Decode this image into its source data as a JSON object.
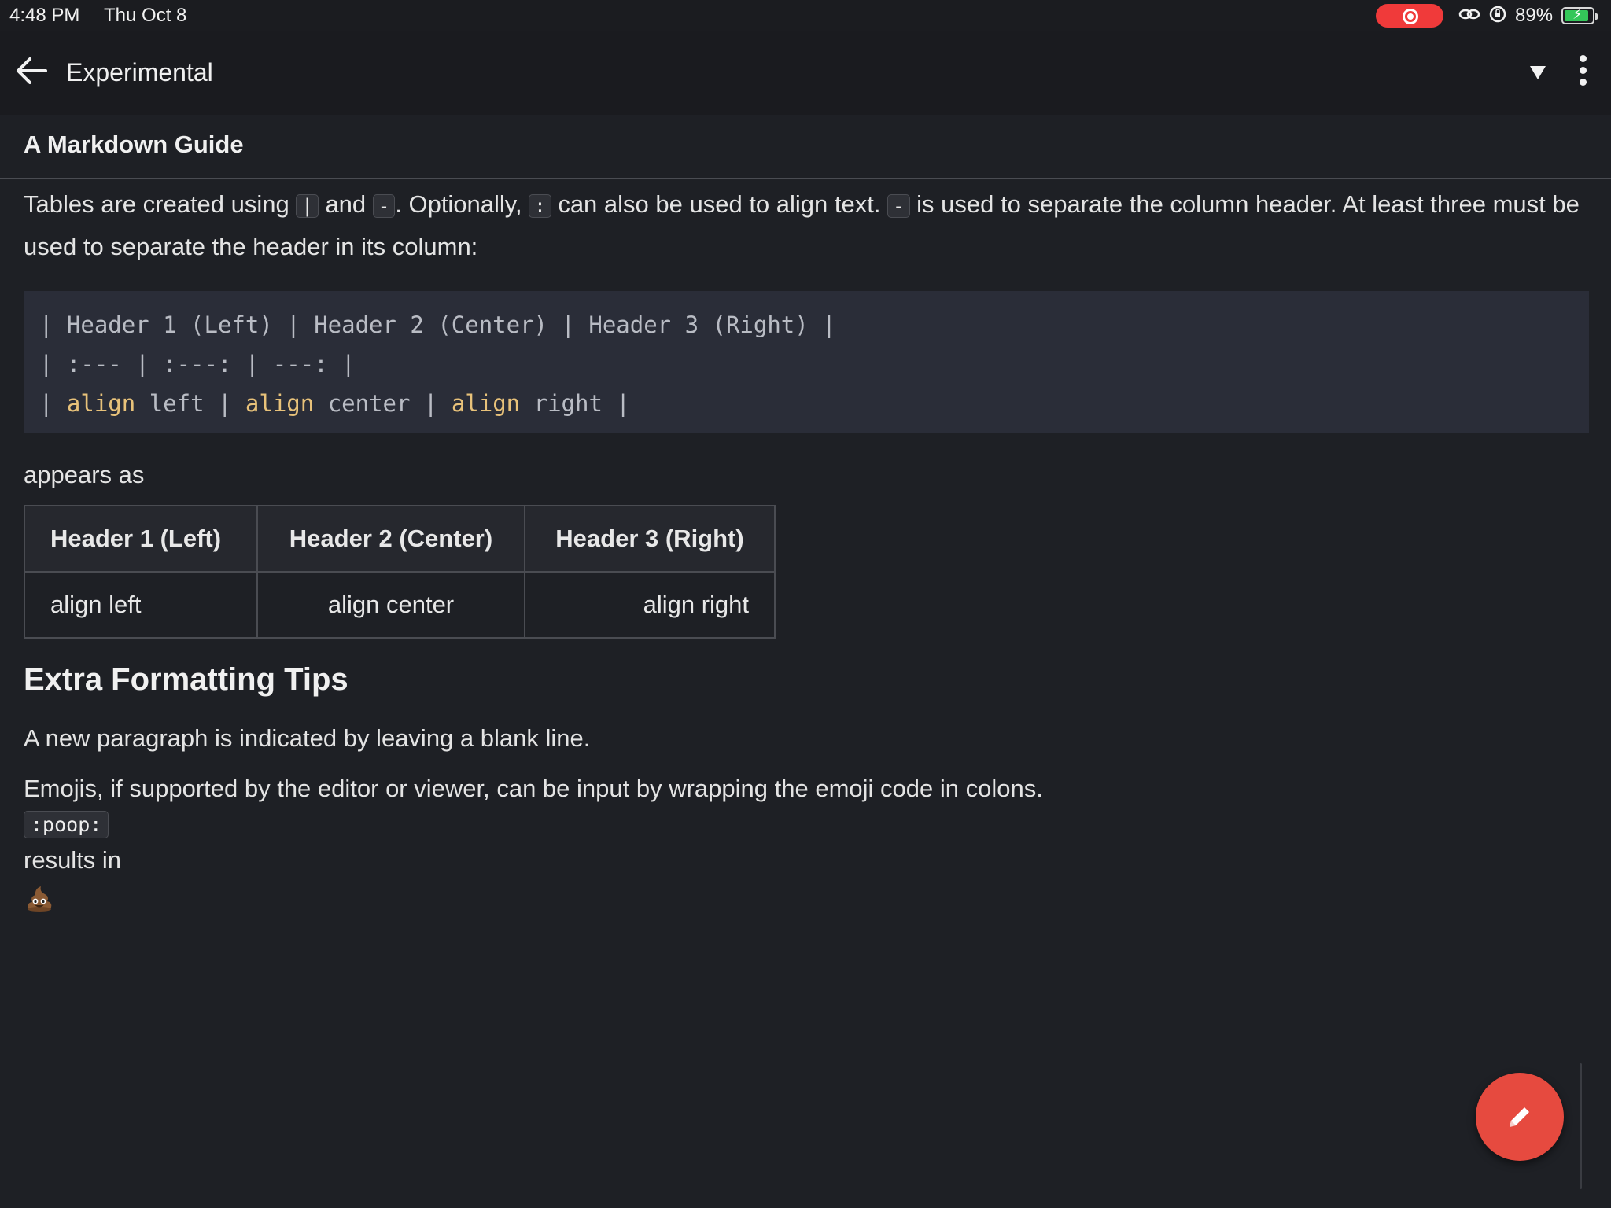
{
  "status_bar": {
    "time": "4:48 PM",
    "date": "Thu Oct 8",
    "battery": "89%",
    "battery_level": 0.89,
    "icons": [
      "screen-record-icon",
      "link-icon",
      "orientation-lock-icon",
      "battery-charging-icon"
    ]
  },
  "app_bar": {
    "title": "Experimental",
    "icons": [
      "back-arrow-icon",
      "dropdown-triangle-icon",
      "more-vertical-icon"
    ]
  },
  "doc": {
    "title": "A Markdown Guide",
    "intro": {
      "t1": "Tables are created using ",
      "c1": "|",
      "t2": " and ",
      "c2": "-",
      "t3": ". Optionally, ",
      "c3": ":",
      "t4": " can also be used to align text. ",
      "c4": "-",
      "t5": " is used to separate the column header. At least three must be used to separate the header in its column:"
    },
    "code_lines": {
      "line1": "| Header 1 (Left) | Header 2 (Center) | Header 3 (Right) |",
      "line2": "| :--- | :---: | ---: |",
      "l3_pipe1": "| ",
      "l3_kw1": "align",
      "l3_t1": " left | ",
      "l3_kw2": "align",
      "l3_t2": " center | ",
      "l3_kw3": "align",
      "l3_t3": " right |"
    },
    "appears_as": "appears as",
    "table": {
      "headers": [
        "Header 1 (Left)",
        "Header 2 (Center)",
        "Header 3 (Right)"
      ],
      "row": [
        "align left",
        "align center",
        "align right"
      ]
    },
    "extra_heading": "Extra Formatting Tips",
    "paragraph_tip": "A new paragraph is indicated by leaving a blank line.",
    "emoji_tip": "Emojis, if supported by the editor or viewer, can be input by wrapping the emoji code in colons.",
    "emoji_code": ":poop:",
    "results_in": "results in"
  },
  "colors": {
    "background": "#1e2025",
    "code_bg": "#2a2d38",
    "code_keyword": "#e8c27a",
    "fab": "#e64a3f",
    "record": "#f03a3a",
    "battery": "#34c759"
  },
  "fab": {
    "icon": "pencil-icon"
  }
}
